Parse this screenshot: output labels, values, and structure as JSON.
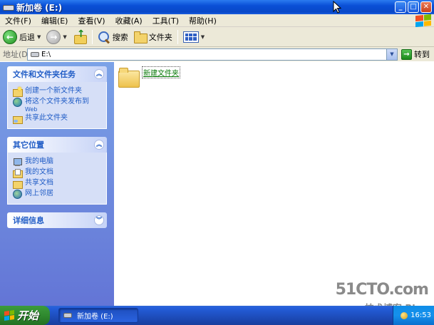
{
  "window": {
    "title": "新加卷 (E:)"
  },
  "menu": [
    "文件(F)",
    "编辑(E)",
    "查看(V)",
    "收藏(A)",
    "工具(T)",
    "帮助(H)"
  ],
  "toolbar": {
    "back_label": "后退",
    "search_label": "搜索",
    "folders_label": "文件夹"
  },
  "address": {
    "label": "地址(D)",
    "value": "E:\\",
    "go_label": "转到"
  },
  "tasks_panel": {
    "title": "文件和文件夹任务",
    "items": [
      {
        "label": "创建一个新文件夹",
        "icon": "new-folder-icon"
      },
      {
        "label": "将这个文件夹发布到",
        "sub": "Web",
        "icon": "web-publish-icon"
      },
      {
        "label": "共享此文件夹",
        "icon": "share-folder-icon"
      }
    ]
  },
  "places_panel": {
    "title": "其它位置",
    "items": [
      {
        "label": "我的电脑",
        "icon": "my-computer-icon"
      },
      {
        "label": "我的文档",
        "icon": "my-documents-icon"
      },
      {
        "label": "共享文档",
        "icon": "shared-documents-icon"
      },
      {
        "label": "网上邻居",
        "icon": "network-places-icon"
      }
    ]
  },
  "details_panel": {
    "title": "详细信息"
  },
  "content": {
    "items": [
      {
        "label": "新建文件夹",
        "icon": "folder-icon"
      }
    ]
  },
  "watermark": {
    "main": "51CTO.com",
    "sub": "技术博客 Blog"
  },
  "taskbar": {
    "start_label": "开始",
    "task_label": "新加卷 (E:)",
    "clock": "16:53"
  },
  "colors": {
    "titlebar": "#0a4fd6",
    "taskpane": "#6f8ede",
    "panel_header_text": "#215dc6",
    "start_button": "#2f8a2f"
  }
}
